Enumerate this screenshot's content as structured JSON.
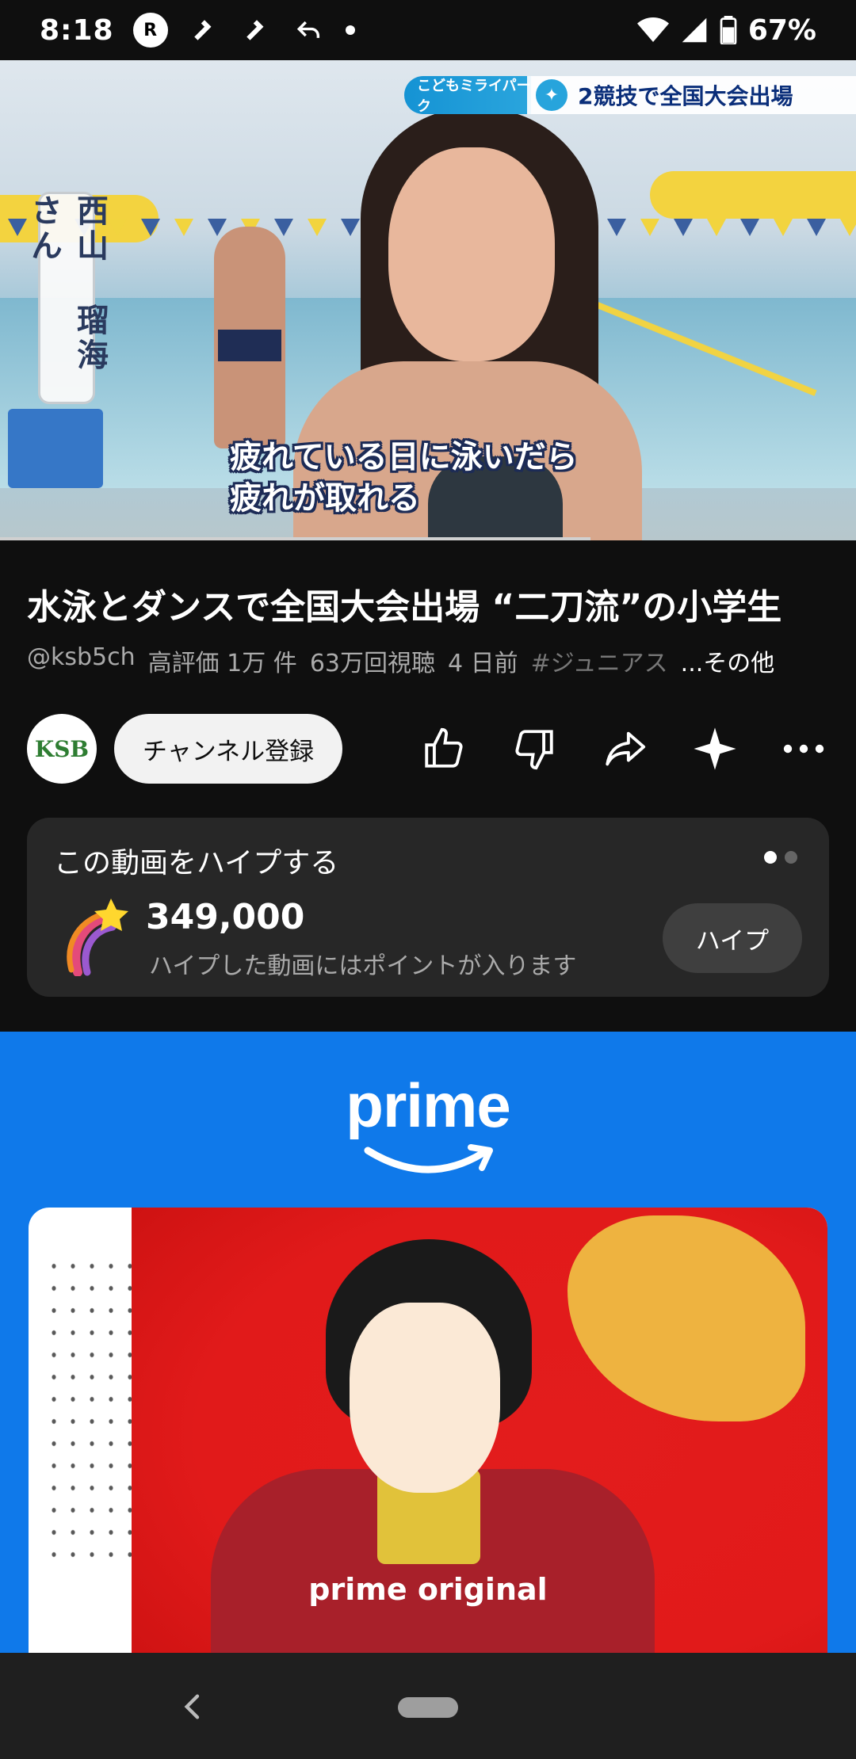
{
  "status_bar": {
    "time": "8:18",
    "rlink_label": "R",
    "battery": "67%",
    "icons": [
      "rlink-icon",
      "hammer-icon",
      "hammer-icon",
      "reply-icon",
      "dot-icon",
      "wifi-icon",
      "signal-icon",
      "battery-icon"
    ]
  },
  "video": {
    "name_plate": "西山 瑠海さん",
    "caption_tag": "こどもミライパーク",
    "caption_main": "2競技で全国大会出場",
    "subtitle_line1": "疲れている日に泳いだら",
    "subtitle_line2": "疲れが取れる",
    "progress_fraction": 0.69
  },
  "info": {
    "title": "水泳とダンスで全国大会出場 “二刀流”の小学生",
    "channel_handle": "@ksb5ch",
    "likes": "高評価 1万 件",
    "views": "63万回視聴",
    "age": "4 日前",
    "hashtag": "#ジュニアス",
    "more": "...その他"
  },
  "actions": {
    "avatar_text": "KSB",
    "subscribe": "チャンネル登録",
    "icons": [
      "like-icon",
      "dislike-icon",
      "share-icon",
      "sparkle-icon",
      "more-icon"
    ]
  },
  "hype": {
    "title": "この動画をハイプする",
    "count": "349,000",
    "description": "ハイプした動画にはポイントが入ります",
    "button": "ハイプ"
  },
  "ad": {
    "logo": "prime",
    "poster_label": "prime original"
  },
  "colors": {
    "background": "#0f0f0f",
    "card": "#272727",
    "ad_blue": "#0f79ea"
  }
}
